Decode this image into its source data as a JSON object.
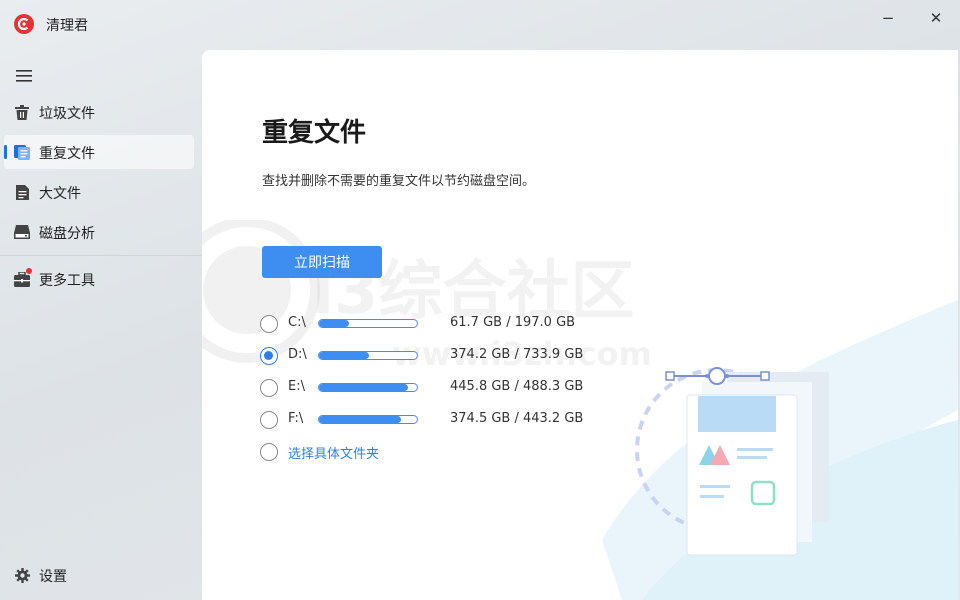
{
  "app": {
    "title": "清理君"
  },
  "window_controls": {
    "minimize": "−",
    "close": "✕"
  },
  "sidebar": {
    "items": [
      {
        "label": "垃圾文件",
        "icon": "trash-icon"
      },
      {
        "label": "重复文件",
        "icon": "duplicate-files-icon",
        "active": true
      },
      {
        "label": "大文件",
        "icon": "document-icon"
      },
      {
        "label": "磁盘分析",
        "icon": "disk-icon"
      },
      {
        "label": "更多工具",
        "icon": "toolbox-icon",
        "badge": true
      }
    ],
    "settings_label": "设置"
  },
  "main": {
    "title": "重复文件",
    "description": "查找并删除不需要的重复文件以节约磁盘空间。",
    "scan_button": "立即扫描",
    "drives": [
      {
        "label": "C:\\",
        "size_text": "61.7 GB / 197.0 GB",
        "used_fraction": 0.31,
        "selected": false
      },
      {
        "label": "D:\\",
        "size_text": "374.2 GB / 733.9 GB",
        "used_fraction": 0.51,
        "selected": true
      },
      {
        "label": "E:\\",
        "size_text": "445.8 GB / 488.3 GB",
        "used_fraction": 0.91,
        "selected": false
      },
      {
        "label": "F:\\",
        "size_text": "374.5 GB / 443.2 GB",
        "used_fraction": 0.84,
        "selected": false
      }
    ],
    "custom_folder_label": "选择具体文件夹"
  },
  "watermark": {
    "text": "i3综合社区",
    "url": "www.i3zh.com"
  },
  "colors": {
    "accent": "#3d8ef0",
    "brand": "#e53238",
    "link": "#2d7fe6"
  }
}
